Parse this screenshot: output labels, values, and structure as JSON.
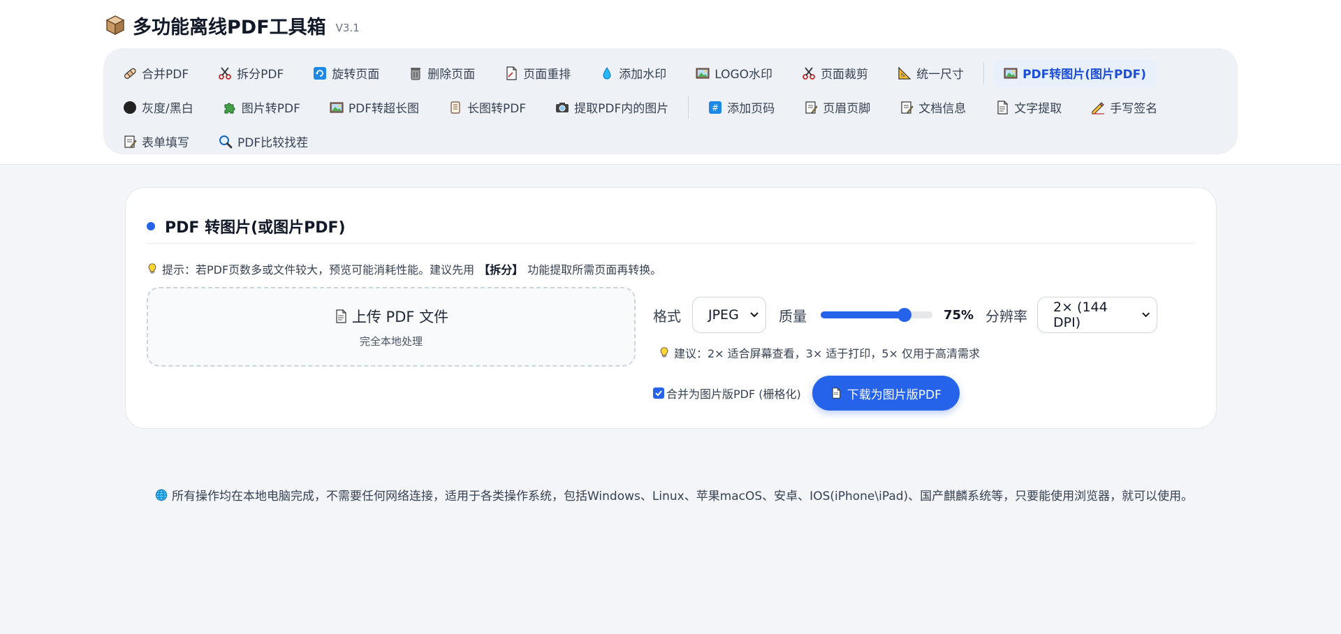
{
  "app": {
    "title": "多功能离线PDF工具箱",
    "version": "V3.1"
  },
  "nav": {
    "row1": [
      {
        "label": "合并PDF",
        "icon": "bandage-icon"
      },
      {
        "label": "拆分PDF",
        "icon": "scissors-icon"
      },
      {
        "label": "旋转页面",
        "icon": "rotate-icon"
      },
      {
        "label": "删除页面",
        "icon": "trash-icon"
      },
      {
        "label": "页面重排",
        "icon": "page-icon"
      },
      {
        "label": "添加水印",
        "icon": "droplet-icon"
      },
      {
        "label": "LOGO水印",
        "icon": "image-icon"
      },
      {
        "label": "页面裁剪",
        "icon": "scissors-icon"
      },
      {
        "label": "统一尺寸",
        "icon": "ruler-icon"
      },
      {
        "label": "PDF转图片(图片PDF)",
        "icon": "image-icon"
      }
    ],
    "row2": [
      {
        "label": "灰度/黑白",
        "icon": "black-circle-icon"
      },
      {
        "label": "图片转PDF",
        "icon": "puzzle-icon"
      },
      {
        "label": "PDF转超长图",
        "icon": "image-icon"
      },
      {
        "label": "长图转PDF",
        "icon": "scroll-icon"
      },
      {
        "label": "提取PDF内的图片",
        "icon": "camera-icon"
      },
      {
        "label": "添加页码",
        "icon": "number-icon"
      },
      {
        "label": "页眉页脚",
        "icon": "memo-icon"
      },
      {
        "label": "文档信息",
        "icon": "memo-icon"
      },
      {
        "label": "文字提取",
        "icon": "page-icon"
      },
      {
        "label": "手写签名",
        "icon": "signature-icon"
      }
    ],
    "row3": [
      {
        "label": "表单填写",
        "icon": "memo-icon"
      },
      {
        "label": "PDF比较找茬",
        "icon": "magnifier-icon"
      }
    ]
  },
  "card": {
    "title": "PDF 转图片(或图片PDF)",
    "tip_prefix": "提示：若PDF页数多或文件较大，预览可能消耗性能。建议先用",
    "tip_bold": "【拆分】",
    "tip_suffix": "功能提取所需页面再转换。",
    "upload_title": "上传 PDF 文件",
    "upload_sub": "完全本地处理",
    "format_label": "格式",
    "format_value": "JPEG",
    "quality_label": "质量",
    "quality_value": "75%",
    "quality_fraction": 0.75,
    "dpi_label": "分辨率",
    "dpi_value": "2× (144 DPI)",
    "hint": "建议：2× 适合屏幕查看，3× 适于打印，5× 仅用于高清需求",
    "merge_label": "合并为图片版PDF (栅格化)",
    "merge_checked": true,
    "download_label": "下载为图片版PDF"
  },
  "footer": "所有操作均在本地电脑完成，不需要任何网络连接，适用于各类操作系统，包括Windows、Linux、苹果macOS、安卓、IOS(iPhone\\iPad)、国产麒麟系统等，只要能使用浏览器，就可以使用。",
  "colors": {
    "accent": "#2563eb",
    "background": "#f3f5f8",
    "nav_bg": "#eef2f7"
  }
}
